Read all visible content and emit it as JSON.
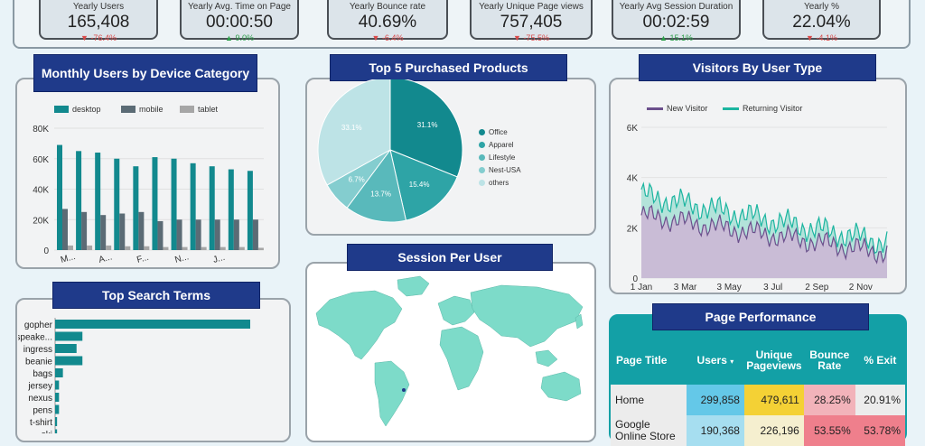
{
  "kpis": [
    {
      "label": "Yearly Users",
      "value": "165,408",
      "delta": "-76.4%",
      "trend": "down"
    },
    {
      "label": "Yearly Avg. Time on Page",
      "value": "00:00:50",
      "delta": "9.0%",
      "trend": "up"
    },
    {
      "label": "Yearly Bounce rate",
      "value": "40.69%",
      "delta": "-6.4%",
      "trend": "down"
    },
    {
      "label": "Yearly Unique Page views",
      "value": "757,405",
      "delta": "-75.5%",
      "trend": "down"
    },
    {
      "label": "Yearly Avg Session Duration",
      "value": "00:02:59",
      "delta": "15.1%",
      "trend": "up"
    },
    {
      "label": "Yearly %",
      "value": "22.04%",
      "delta": "-4.1%",
      "trend": "down"
    }
  ],
  "device_chart": {
    "title": "Monthly Users by Device Category",
    "legend": [
      "desktop",
      "mobile",
      "tablet"
    ],
    "colors": {
      "desktop": "#12898e",
      "mobile": "#5b6b75",
      "tablet": "#a6a6a6",
      "accent": "#1f3a8a"
    },
    "y_ticks": [
      "80K",
      "60K",
      "40K",
      "20K",
      "0"
    ],
    "x_ticks": [
      "M...",
      "A...",
      "F...",
      "N...",
      "J..."
    ]
  },
  "products_chart": {
    "title": "Top 5 Purchased Products",
    "legend": [
      "Office",
      "Apparel",
      "Lifestyle",
      "Nest-USA",
      "others"
    ],
    "slice_labels": [
      "31.1%",
      "15.4%",
      "13.7%",
      "6.7%",
      "33.1%"
    ]
  },
  "visitor_chart": {
    "title": "Visitors By User Type",
    "legend": [
      "New Visitor",
      "Returning Visitor"
    ],
    "y_ticks": [
      "6K",
      "4K",
      "2K",
      "0"
    ],
    "x_ticks": [
      "1 Jan",
      "3 Mar",
      "3 May",
      "3 Jul",
      "2 Sep",
      "2 Nov"
    ]
  },
  "search_chart": {
    "title": "Top Search Terms",
    "terms": [
      "gopher",
      "speake...",
      "ingress",
      "beanie",
      "bags",
      "jersey",
      "nexus",
      "pens",
      "t-shirt",
      "ski"
    ]
  },
  "session_map": {
    "title": "Session Per User"
  },
  "page_performance": {
    "title": "Page Performance",
    "headers": [
      "Page Title",
      "Users",
      "Unique Pageviews",
      "Bounce Rate",
      "% Exit"
    ],
    "sort_indicator": "▾",
    "rows": [
      [
        "Home",
        "299,858",
        "479,611",
        "28.25%",
        "20.91%"
      ],
      [
        "Google Online Store",
        "190,368",
        "226,196",
        "53.55%",
        "53.78%"
      ]
    ]
  },
  "chart_data": [
    {
      "type": "bar",
      "title": "Monthly Users by Device Category",
      "ylim": [
        0,
        80000
      ],
      "categories": [
        "M...",
        "",
        "A...",
        "",
        "F...",
        "",
        "N...",
        "",
        "J...",
        "",
        ""
      ],
      "series": [
        {
          "name": "desktop",
          "values": [
            69000,
            65000,
            64000,
            60000,
            55000,
            61000,
            60000,
            57000,
            55000,
            53000,
            52000
          ]
        },
        {
          "name": "mobile",
          "values": [
            27000,
            25000,
            23000,
            24000,
            25000,
            19000,
            20000,
            20000,
            20000,
            20000,
            20000
          ]
        },
        {
          "name": "tablet",
          "values": [
            3000,
            3000,
            3000,
            2500,
            2500,
            2000,
            2000,
            2000,
            2000,
            2000,
            1500
          ]
        }
      ]
    },
    {
      "type": "pie",
      "title": "Top 5 Purchased Products",
      "categories": [
        "Office",
        "Apparel",
        "Lifestyle",
        "Nest-USA",
        "others"
      ],
      "values": [
        31.1,
        15.4,
        13.7,
        6.7,
        33.1
      ]
    },
    {
      "type": "area",
      "title": "Visitors By User Type",
      "ylim": [
        0,
        6000
      ],
      "x_ticks": [
        "1 Jan",
        "3 Mar",
        "3 May",
        "3 Jul",
        "2 Sep",
        "2 Nov"
      ],
      "series": [
        {
          "name": "New Visitor",
          "start": 2500,
          "end": 1000,
          "spread": 600
        },
        {
          "name": "Returning Visitor",
          "start": 3300,
          "end": 1400,
          "spread": 700
        }
      ]
    },
    {
      "type": "bar",
      "title": "Top Search Terms",
      "categories": [
        "gopher",
        "speake...",
        "ingress",
        "beanie",
        "bags",
        "jersey",
        "nexus",
        "pens",
        "t-shirt",
        "ski"
      ],
      "values": [
        100,
        14,
        11,
        14,
        4,
        2,
        2,
        2,
        1,
        1
      ]
    }
  ]
}
